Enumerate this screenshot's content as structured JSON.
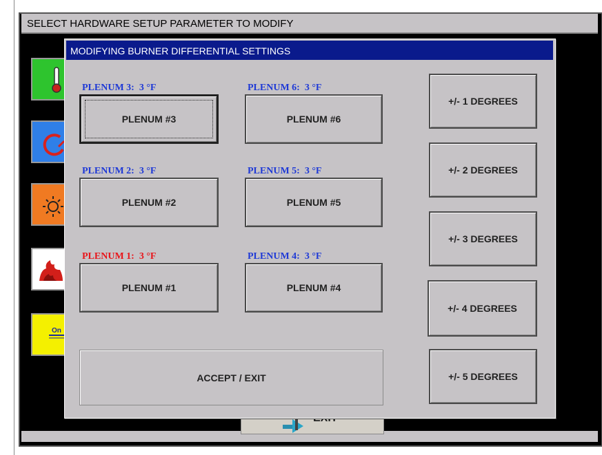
{
  "outer_window": {
    "title": "SELECT HARDWARE SETUP PARAMETER TO MODIFY",
    "exit_label": "EXIT"
  },
  "sidebar_icons": [
    {
      "name": "thermometer-icon",
      "color": "#2ec42e"
    },
    {
      "name": "gauge-icon",
      "color": "#2f7fe8"
    },
    {
      "name": "sun-icon",
      "color": "#f07a22"
    },
    {
      "name": "fire-icon",
      "color": "#ffffff"
    },
    {
      "name": "on-switch-icon",
      "color": "#f4f000"
    }
  ],
  "dialog": {
    "title": "MODIFYING BURNER DIFFERENTIAL SETTINGS",
    "plenums": {
      "p3": {
        "label": "PLENUM 3:  3 °F",
        "button": "PLENUM #3"
      },
      "p6": {
        "label": "PLENUM 6:  3 °F",
        "button": "PLENUM #6"
      },
      "p2": {
        "label": "PLENUM 2:  3 °F",
        "button": "PLENUM #2"
      },
      "p5": {
        "label": "PLENUM 5:  3 °F",
        "button": "PLENUM #5"
      },
      "p1": {
        "label": "PLENUM 1:  3 °F",
        "button": "PLENUM #1"
      },
      "p4": {
        "label": "PLENUM 4:  3 °F",
        "button": "PLENUM #4"
      }
    },
    "degree_buttons": [
      "+/- 1 DEGREES",
      "+/- 2 DEGREES",
      "+/- 3 DEGREES",
      "+/- 4 DEGREES",
      "+/- 5 DEGREES"
    ],
    "accept_label": "ACCEPT / EXIT"
  },
  "colors": {
    "title_bar": "#0a1a8c",
    "label_blue": "#1f3ad6",
    "label_red": "#e8161b"
  }
}
